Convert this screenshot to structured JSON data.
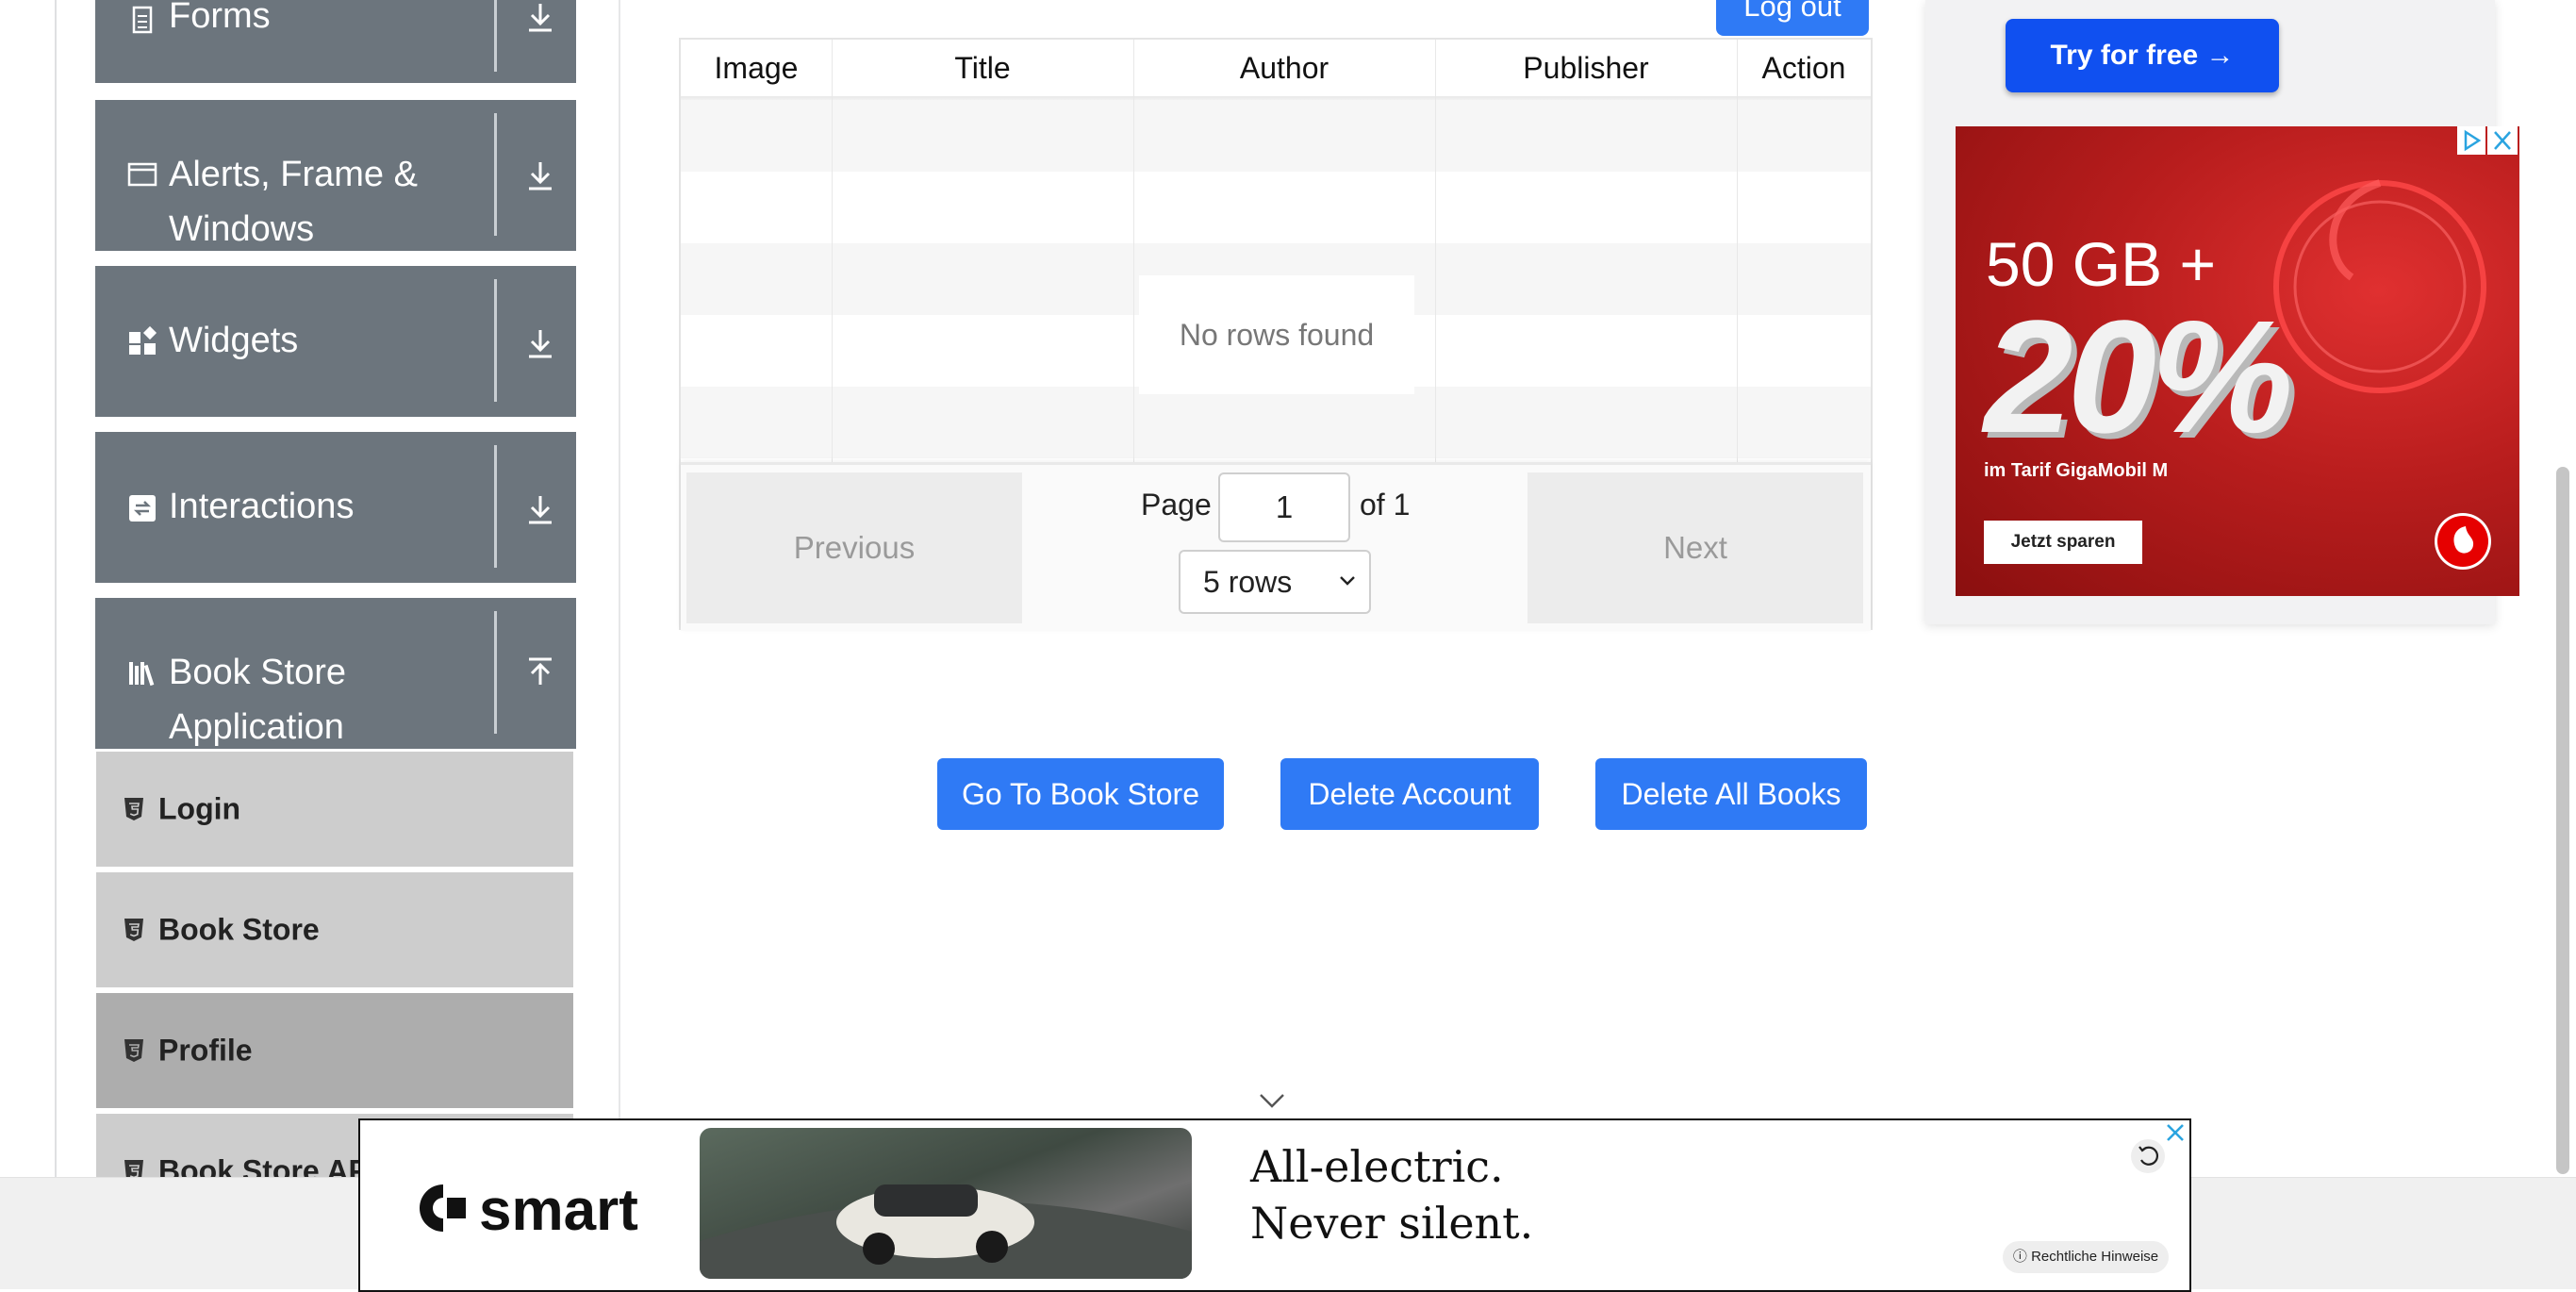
{
  "sidebar": {
    "groups": [
      {
        "label": "Forms",
        "icon": "document-icon",
        "arrow": "download-icon"
      },
      {
        "label": "Alerts, Frame & Windows",
        "icon": "window-icon",
        "arrow": "download-icon"
      },
      {
        "label": "Widgets",
        "icon": "widgets-icon",
        "arrow": "download-icon"
      },
      {
        "label": "Interactions",
        "icon": "interactions-icon",
        "arrow": "download-icon"
      },
      {
        "label": "Book Store Application",
        "icon": "books-icon",
        "arrow": "upload-icon"
      }
    ],
    "subitems": [
      {
        "label": "Login",
        "active": false
      },
      {
        "label": "Book Store",
        "active": false
      },
      {
        "label": "Profile",
        "active": true
      },
      {
        "label": "Book Store API",
        "active": false
      }
    ]
  },
  "header": {
    "logout_label": "Log out"
  },
  "table": {
    "columns": [
      "Image",
      "Title",
      "Author",
      "Publisher",
      "Action"
    ],
    "empty_text": "No rows found",
    "pagination": {
      "previous": "Previous",
      "next": "Next",
      "page_label": "Page",
      "page_value": "1",
      "of_label": "of 1",
      "rows_option": "5 rows"
    }
  },
  "actions": {
    "go_to_store": "Go To Book Store",
    "delete_account": "Delete Account",
    "delete_all_books": "Delete All Books"
  },
  "right_ad": {
    "try_free": "Try for free →",
    "headline": "50 GB +",
    "percent": "20%",
    "tarif": "im Tarif GigaMobil M",
    "cta": "Jetzt sparen"
  },
  "bottom_ad": {
    "brand": "smart",
    "line1": "All-electric.",
    "line2": "Never silent.",
    "legal": "Rechtliche Hinweise"
  },
  "colors": {
    "primary": "#2f7af5",
    "sidebar_group": "#6c757d",
    "sidebar_sub": "#cdcdcd",
    "sidebar_active": "#adadad",
    "vodafone_red": "#b81d1d"
  }
}
